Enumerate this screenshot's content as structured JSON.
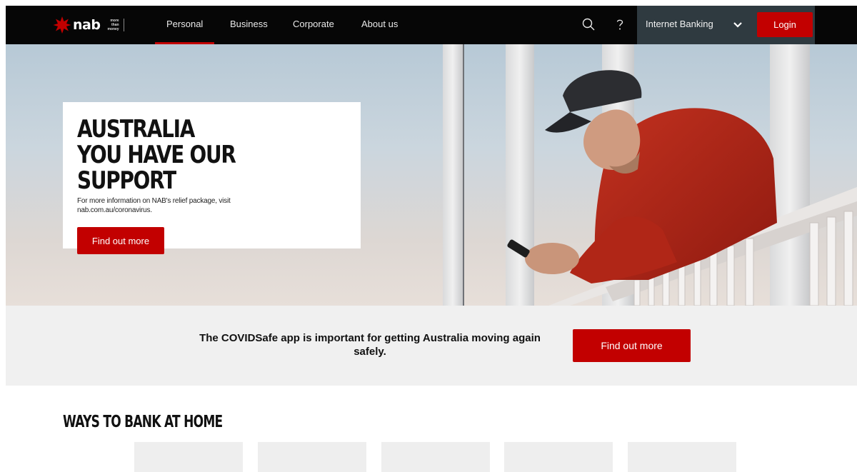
{
  "nav": {
    "brand": "nab",
    "tagline": [
      "more",
      "than",
      "money"
    ],
    "links": [
      {
        "label": "Personal",
        "active": true
      },
      {
        "label": "Business",
        "active": false
      },
      {
        "label": "Corporate",
        "active": false
      },
      {
        "label": "About us",
        "active": false
      }
    ],
    "icons": [
      "search-icon",
      "help-icon"
    ],
    "internet_banking": {
      "label": "Internet Banking",
      "icon": "chevron-down-icon"
    },
    "login_label": "Login"
  },
  "hero": {
    "title_line1": "AUSTRALIA",
    "title_line2": "YOU HAVE OUR SUPPORT",
    "text": "For more information on NAB's relief package, visit nab.com.au/coronavirus.",
    "button_label": "Find out more"
  },
  "covid_band": {
    "text": "The COVIDSafe app is important for getting Australia moving again safely.",
    "button_label": "Find out more"
  },
  "ways_to_bank": {
    "title": "WAYS TO BANK AT HOME"
  },
  "colors": {
    "brand_red": "#c20000",
    "nav_background": "#060606",
    "internet_banking_background": "#2f3a40"
  }
}
